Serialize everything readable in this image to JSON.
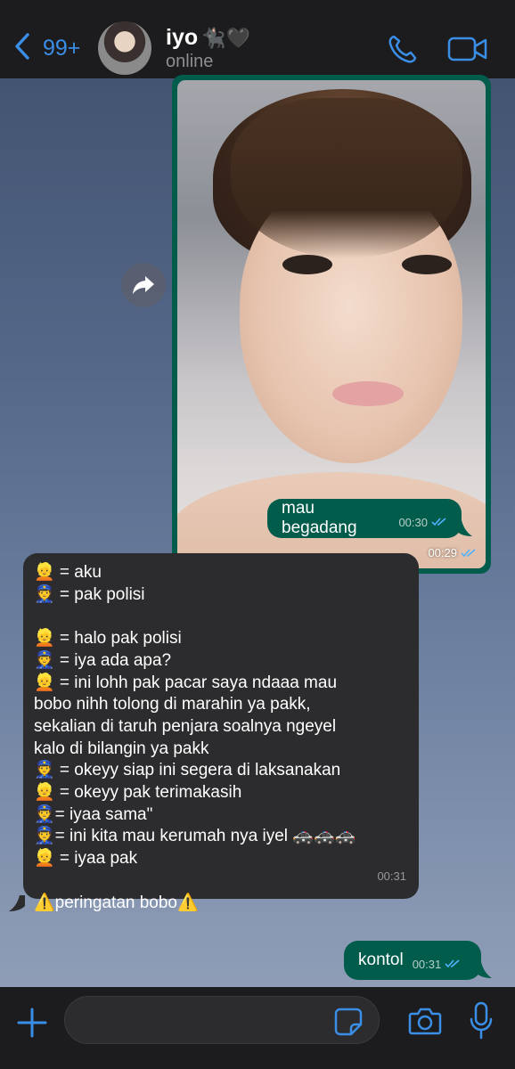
{
  "header": {
    "back_icon": "chevron-left-icon",
    "unread_count": "99+",
    "contact_name": "iyo",
    "contact_name_emoji": "🐈‍⬛🖤",
    "status": "online",
    "call_icon": "phone-icon",
    "video_icon": "video-camera-icon",
    "accent_color": "#3a8ee6"
  },
  "messages": {
    "photo": {
      "time": "00:29",
      "ticks": "double-check-icon"
    },
    "out1": {
      "text": "mau begadang",
      "time": "00:30"
    },
    "incoming": {
      "lines": [
        "👱 = aku",
        "👮 = pak polisi",
        "",
        "👱 = halo pak polisi",
        "👮 = iya ada apa?",
        "👱 = ini lohh pak pacar saya ndaaa mau",
        "bobo nihh tolong di marahin ya pakk,",
        "sekalian di taruh penjara soalnya ngeyel",
        "kalo di bilangin ya pakk",
        "👮 = okeyy siap ini segera di laksanakan",
        "👱 = okeyy pak terimakasih",
        "👮= iyaa sama\"",
        "👮= ini kita mau kerumah nya iyel 🚓🚓🚓",
        "👱 = iyaa pak",
        "",
        "⚠️peringatan bobo⚠️"
      ],
      "time": "00:31"
    },
    "out2": {
      "text": "kontol",
      "time": "00:31"
    },
    "outgoing_bubble_color": "#025c4c",
    "incoming_bubble_color": "#2c2c2e",
    "read_tick_color": "#4fb3ff"
  },
  "input": {
    "placeholder": "",
    "value": "",
    "plus_icon": "plus-icon",
    "sticker_icon": "sticker-icon",
    "camera_icon": "camera-icon",
    "mic_icon": "microphone-icon"
  }
}
